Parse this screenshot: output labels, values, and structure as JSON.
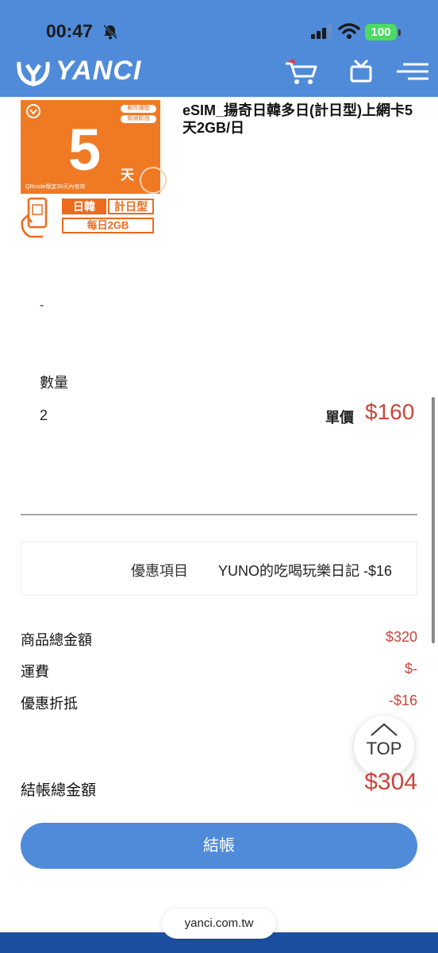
{
  "status_bar": {
    "time": "00:47",
    "battery": "100"
  },
  "header": {
    "brand": "YANCI",
    "accent_color": "#4f8bd9"
  },
  "product": {
    "title": "eSIM_揚奇日韓多日(計日型)上網卡5天2GB/日",
    "image": {
      "days": "5",
      "day_unit": "天",
      "region_tag": "日韓",
      "type_tag": "計日型",
      "data_tag": "每日2GB",
      "qr_note": "QRcode限定30天內有效",
      "badge_1": "郵件傳取",
      "badge_2": "即掃即用"
    },
    "variant": "-",
    "quantity_label": "數量",
    "quantity_value": "2",
    "unit_price_label": "單價",
    "unit_price": "$160"
  },
  "discount": {
    "label": "優惠項目",
    "value": "YUNO的吃喝玩樂日記 -$16"
  },
  "summary": {
    "rows": [
      {
        "label": "商品總金額",
        "value": "$320"
      },
      {
        "label": "運費",
        "value": "$-"
      },
      {
        "label": "優惠折抵",
        "value": "-$16"
      }
    ],
    "total_label": "結帳總金額",
    "total_value": "$304"
  },
  "top_button": "TOP",
  "checkout_button": "結帳",
  "browser": {
    "url": "yanci.com.tw"
  },
  "colors": {
    "price_red": "#c9463d",
    "product_orange": "#f07a24",
    "footer_blue": "#1d4fa0"
  }
}
